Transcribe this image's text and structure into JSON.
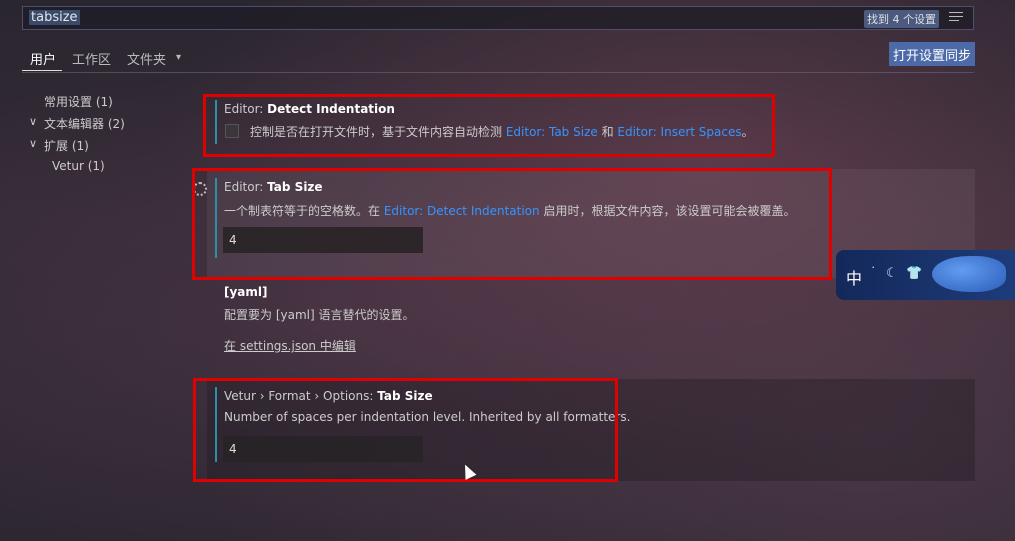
{
  "search": {
    "query": "tabsize",
    "found_label": "找到 4 个设置",
    "filter_icon": "filter-lines-icon"
  },
  "tabs": {
    "user": "用户",
    "workspace": "工作区",
    "folder": "文件夹",
    "folder_chevron": "▾",
    "sync_button": "打开设置同步"
  },
  "toc": [
    {
      "label": "常用设置 (1)",
      "chevron": ""
    },
    {
      "label": "文本编辑器 (2)",
      "chevron": "∨"
    },
    {
      "label": "扩展 (1)",
      "chevron": "∨"
    },
    {
      "label": "Vetur (1)",
      "chevron": ""
    }
  ],
  "settings": {
    "detect_indentation": {
      "prefix": "Editor: ",
      "name": "Detect Indentation",
      "desc_before": "控制是否在打开文件时，基于文件内容自动检测 ",
      "link1": "Editor: Tab Size",
      "desc_middle": " 和 ",
      "link2": "Editor: Insert Spaces",
      "desc_after": "。",
      "checked": false
    },
    "tab_size": {
      "prefix": "Editor: ",
      "name": "Tab Size",
      "desc_before": "一个制表符等于的空格数。在 ",
      "link": "Editor: Detect Indentation",
      "desc_after": " 启用时，根据文件内容，该设置可能会被覆盖。",
      "value": "4"
    },
    "yaml": {
      "title": "[yaml]",
      "desc": "配置要为 [yaml] 语言替代的设置。",
      "edit_link": "在 settings.json 中编辑"
    },
    "vetur_tab_size": {
      "prefix": "Vetur › Format › Options: ",
      "name": "Tab Size",
      "desc": "Number of spaces per indentation level. Inherited by all formatters.",
      "value": "4"
    }
  },
  "ime": {
    "lang": "中",
    "symbols": [
      "˙",
      "☾",
      "👕"
    ]
  },
  "colors": {
    "accent_link": "#3794ff",
    "highlight_box": "#e00000",
    "sync_button_bg": "#4d6aa8",
    "setting_bar": "#2e8ea6"
  }
}
